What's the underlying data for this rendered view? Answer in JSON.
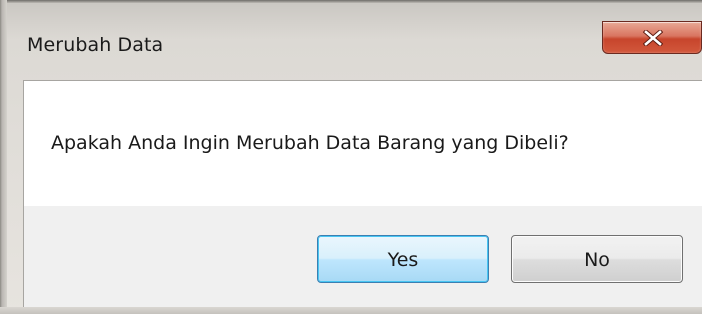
{
  "window": {
    "title": "Merubah Data",
    "close_icon": "close-icon"
  },
  "message": {
    "text": "Apakah Anda Ingin Merubah Data Barang yang Dibeli?"
  },
  "buttons": {
    "yes_label": "Yes",
    "no_label": "No"
  },
  "colors": {
    "close_button": "#c7452c",
    "default_button_border": "#3c7fb1",
    "content_background": "#ffffff",
    "footer_background": "#f0f0f0"
  }
}
